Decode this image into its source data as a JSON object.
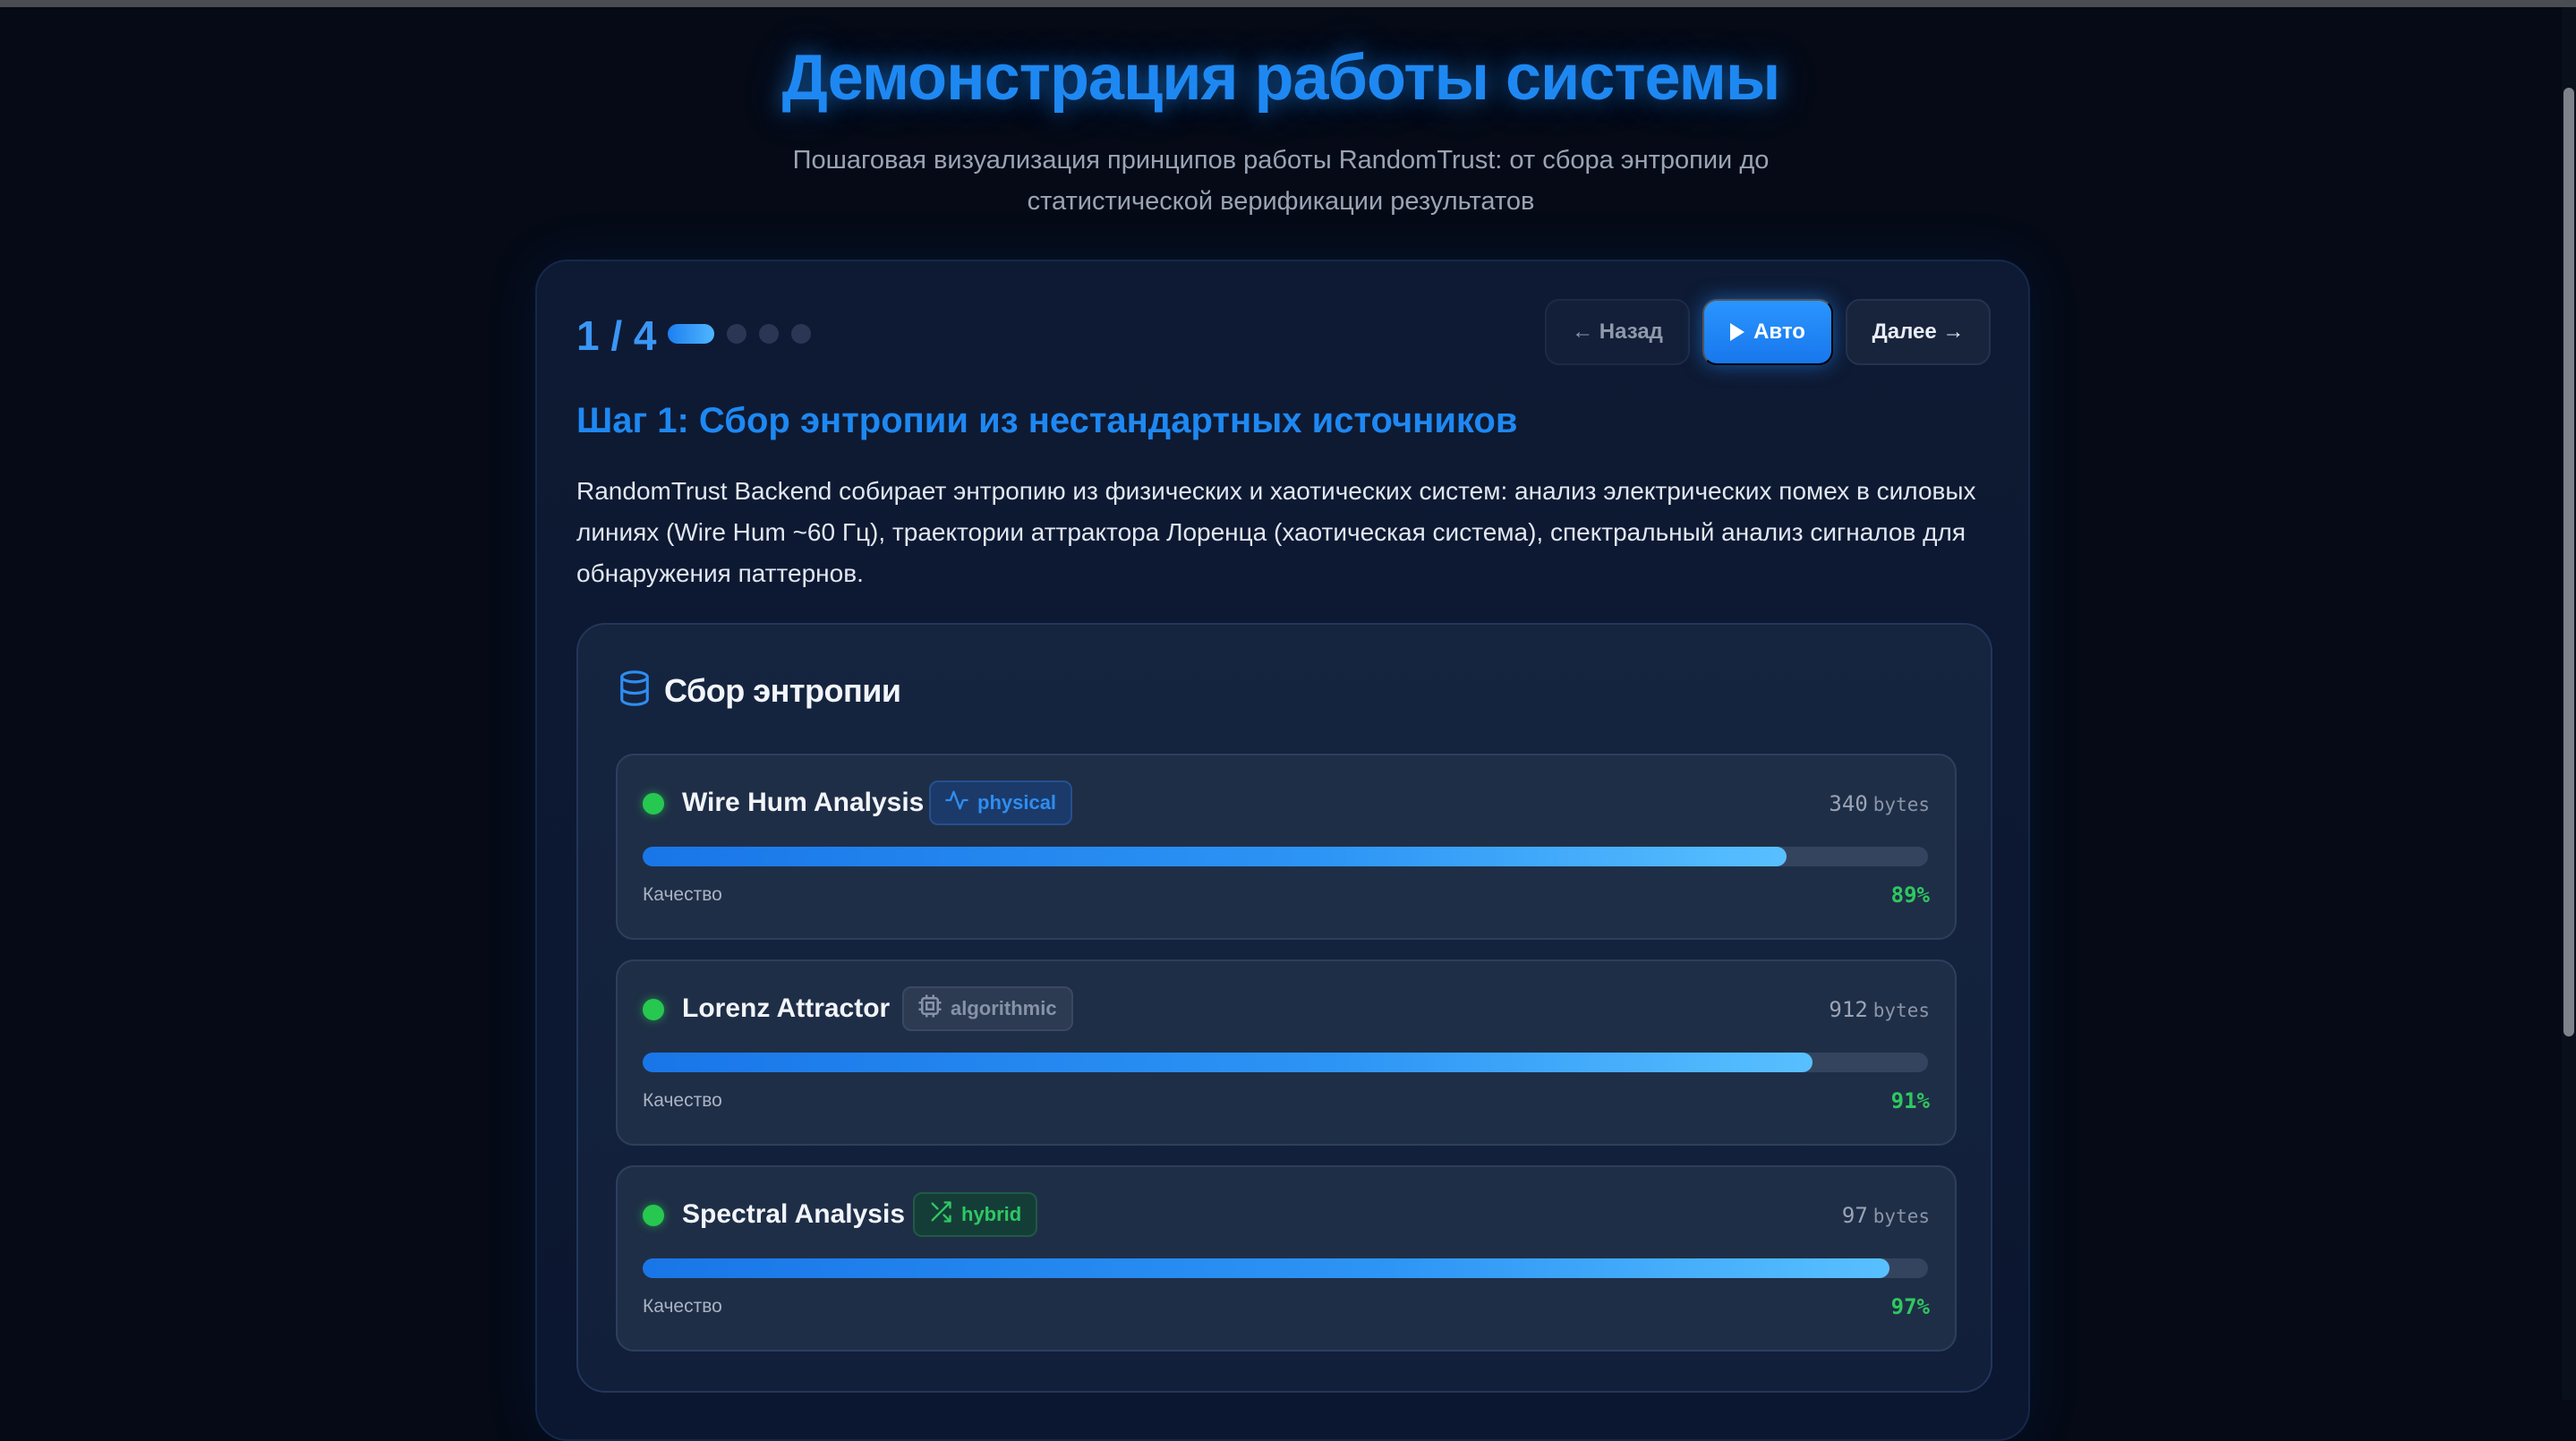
{
  "header": {
    "title": "Демонстрация работы системы",
    "subtitle": "Пошаговая визуализация принципов работы RandomTrust: от сбора энтропии до статистической верификации результатов"
  },
  "stepper": {
    "counter": "1 / 4",
    "total_steps": 4,
    "active_step": 1
  },
  "controls": {
    "back_label": "← Назад",
    "auto_label": "Авто",
    "next_label": "Далее →"
  },
  "step": {
    "title": "Шаг 1: Сбор энтропии из нестандартных источников",
    "description": "RandomTrust Backend собирает энтропию из физических и хаотических систем: анализ электрических помех в силовых линиях (Wire Hum ~60 Гц), траектории аттрактора Лоренца (хаотическая система), спектральный анализ сигналов для обнаружения паттернов."
  },
  "entropy_card": {
    "title": "Сбор энтропии",
    "icon": "database-icon",
    "quality_label": "Качество",
    "bytes_unit": "bytes",
    "sources": [
      {
        "name": "Wire Hum Analysis",
        "tag": "physical",
        "tag_icon": "activity-icon",
        "bytes": "340",
        "quality": 0.89,
        "quality_text": "89%"
      },
      {
        "name": "Lorenz Attractor",
        "tag": "algorithmic",
        "tag_icon": "cpu-icon",
        "bytes": "912",
        "quality": 0.91,
        "quality_text": "91%"
      },
      {
        "name": "Spectral Analysis",
        "tag": "hybrid",
        "tag_icon": "shuffle-icon",
        "bytes": "97",
        "quality": 0.97,
        "quality_text": "97%"
      }
    ]
  },
  "colors": {
    "accent": "#1e88f2",
    "success": "#2ec85f",
    "background": "#050a16"
  }
}
